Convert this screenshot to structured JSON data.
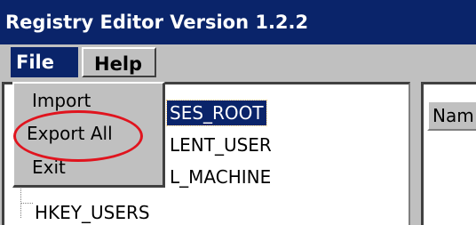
{
  "window": {
    "title": "Registry Editor Version 1.2.2"
  },
  "menubar": {
    "items": [
      {
        "label": "File"
      },
      {
        "label": "Help"
      }
    ]
  },
  "file_menu": {
    "items": [
      {
        "label": "Import"
      },
      {
        "label": "Export All"
      },
      {
        "label": "Exit"
      }
    ]
  },
  "tree": {
    "items": [
      {
        "label": "SES_ROOT"
      },
      {
        "label": "LENT_USER"
      },
      {
        "label": "L_MACHINE"
      },
      {
        "label": "HKEY_USERS"
      }
    ]
  },
  "list_view": {
    "columns": [
      {
        "label": "Nam"
      }
    ]
  },
  "colors": {
    "title_bar": "#0a246a",
    "window_bg": "#c0c0c0",
    "annotation_ring": "#e0141e"
  }
}
